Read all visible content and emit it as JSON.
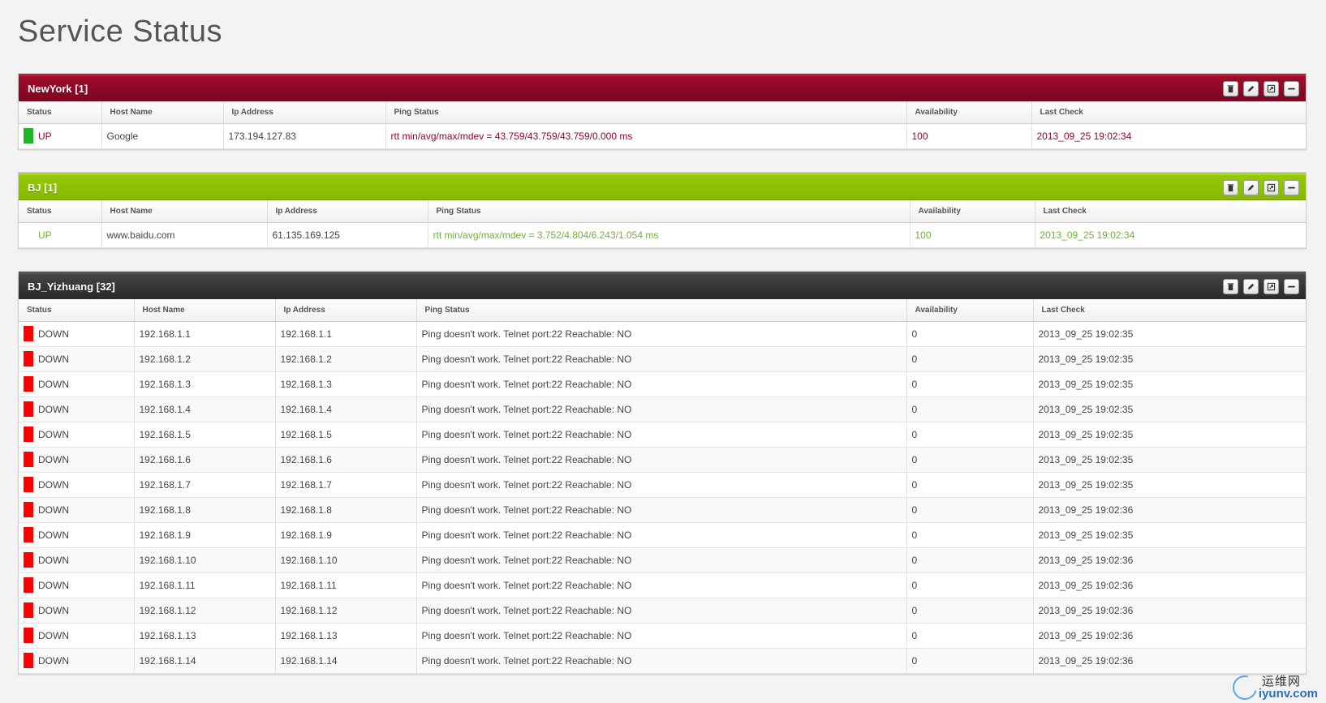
{
  "page": {
    "title": "Service Status"
  },
  "colors": {
    "newyork_header": "#8b0a27",
    "bj_header": "#8cc100",
    "yizhuang_header": "#333333",
    "status_up": "#1fb528",
    "status_down": "#ff0000"
  },
  "widgets": [
    {
      "title": "NewYork [1]",
      "columns": [
        "Status",
        "Host Name",
        "Ip Address",
        "Ping Status",
        "Availability",
        "Last Check"
      ],
      "rows": [
        {
          "status": "UP",
          "indicator": "green",
          "host": "Google",
          "ip": "173.194.127.83",
          "ping": "rtt min/avg/max/mdev = 43.759/43.759/43.759/0.000 ms",
          "availability": "100",
          "last_check": "2013_09_25 19:02:34"
        }
      ]
    },
    {
      "title": "BJ [1]",
      "columns": [
        "Status",
        "Host Name",
        "Ip Address",
        "Ping Status",
        "Availability",
        "Last Check"
      ],
      "rows": [
        {
          "status": "UP",
          "indicator": "none",
          "host": "www.baidu.com",
          "ip": "61.135.169.125",
          "ping": "rtt min/avg/max/mdev = 3.752/4.804/6.243/1.054 ms",
          "availability": "100",
          "last_check": "2013_09_25 19:02:34"
        }
      ]
    },
    {
      "title": "BJ_Yizhuang [32]",
      "columns": [
        "Status",
        "Host Name",
        "Ip Address",
        "Ping Status",
        "Availability",
        "Last Check"
      ],
      "rows": [
        {
          "status": "DOWN",
          "indicator": "red",
          "host": "192.168.1.1",
          "ip": "192.168.1.1",
          "ping": "Ping doesn't work. Telnet port:22 Reachable: NO",
          "availability": "0",
          "last_check": "2013_09_25 19:02:35"
        },
        {
          "status": "DOWN",
          "indicator": "red",
          "host": "192.168.1.2",
          "ip": "192.168.1.2",
          "ping": "Ping doesn't work. Telnet port:22 Reachable: NO",
          "availability": "0",
          "last_check": "2013_09_25 19:02:35"
        },
        {
          "status": "DOWN",
          "indicator": "red",
          "host": "192.168.1.3",
          "ip": "192.168.1.3",
          "ping": "Ping doesn't work. Telnet port:22 Reachable: NO",
          "availability": "0",
          "last_check": "2013_09_25 19:02:35"
        },
        {
          "status": "DOWN",
          "indicator": "red",
          "host": "192.168.1.4",
          "ip": "192.168.1.4",
          "ping": "Ping doesn't work. Telnet port:22 Reachable: NO",
          "availability": "0",
          "last_check": "2013_09_25 19:02:35"
        },
        {
          "status": "DOWN",
          "indicator": "red",
          "host": "192.168.1.5",
          "ip": "192.168.1.5",
          "ping": "Ping doesn't work. Telnet port:22 Reachable: NO",
          "availability": "0",
          "last_check": "2013_09_25 19:02:35"
        },
        {
          "status": "DOWN",
          "indicator": "red",
          "host": "192.168.1.6",
          "ip": "192.168.1.6",
          "ping": "Ping doesn't work. Telnet port:22 Reachable: NO",
          "availability": "0",
          "last_check": "2013_09_25 19:02:35"
        },
        {
          "status": "DOWN",
          "indicator": "red",
          "host": "192.168.1.7",
          "ip": "192.168.1.7",
          "ping": "Ping doesn't work. Telnet port:22 Reachable: NO",
          "availability": "0",
          "last_check": "2013_09_25 19:02:35"
        },
        {
          "status": "DOWN",
          "indicator": "red",
          "host": "192.168.1.8",
          "ip": "192.168.1.8",
          "ping": "Ping doesn't work. Telnet port:22 Reachable: NO",
          "availability": "0",
          "last_check": "2013_09_25 19:02:36"
        },
        {
          "status": "DOWN",
          "indicator": "red",
          "host": "192.168.1.9",
          "ip": "192.168.1.9",
          "ping": "Ping doesn't work. Telnet port:22 Reachable: NO",
          "availability": "0",
          "last_check": "2013_09_25 19:02:35"
        },
        {
          "status": "DOWN",
          "indicator": "red",
          "host": "192.168.1.10",
          "ip": "192.168.1.10",
          "ping": "Ping doesn't work. Telnet port:22 Reachable: NO",
          "availability": "0",
          "last_check": "2013_09_25 19:02:36"
        },
        {
          "status": "DOWN",
          "indicator": "red",
          "host": "192.168.1.11",
          "ip": "192.168.1.11",
          "ping": "Ping doesn't work. Telnet port:22 Reachable: NO",
          "availability": "0",
          "last_check": "2013_09_25 19:02:36"
        },
        {
          "status": "DOWN",
          "indicator": "red",
          "host": "192.168.1.12",
          "ip": "192.168.1.12",
          "ping": "Ping doesn't work. Telnet port:22 Reachable: NO",
          "availability": "0",
          "last_check": "2013_09_25 19:02:36"
        },
        {
          "status": "DOWN",
          "indicator": "red",
          "host": "192.168.1.13",
          "ip": "192.168.1.13",
          "ping": "Ping doesn't work. Telnet port:22 Reachable: NO",
          "availability": "0",
          "last_check": "2013_09_25 19:02:36"
        },
        {
          "status": "DOWN",
          "indicator": "red",
          "host": "192.168.1.14",
          "ip": "192.168.1.14",
          "ping": "Ping doesn't work. Telnet port:22 Reachable: NO",
          "availability": "0",
          "last_check": "2013_09_25 19:02:36"
        }
      ]
    }
  ],
  "watermark": {
    "cn": "运维网",
    "en": "iyunv.com"
  }
}
